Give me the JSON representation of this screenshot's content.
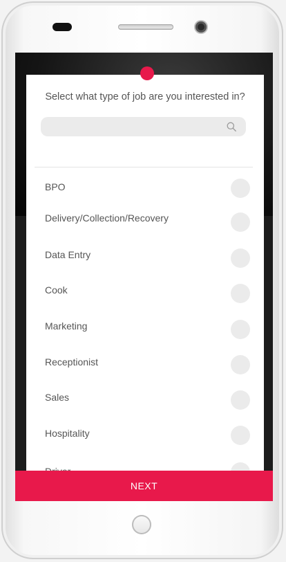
{
  "screen": {
    "prompt": "Select what type of job are you interested in?",
    "search": {
      "placeholder": "",
      "icon": "search-icon"
    },
    "job_types": [
      {
        "label": "BPO",
        "selected": false
      },
      {
        "label": "Delivery/Collection/Recovery",
        "selected": false
      },
      {
        "label": "Data Entry",
        "selected": false
      },
      {
        "label": "Cook",
        "selected": false
      },
      {
        "label": "Marketing",
        "selected": false
      },
      {
        "label": "Receptionist",
        "selected": false
      },
      {
        "label": "Sales",
        "selected": false
      },
      {
        "label": "Hospitality",
        "selected": false
      },
      {
        "label": "Driver",
        "selected": false
      }
    ],
    "next_label": "NEXT"
  },
  "colors": {
    "accent": "#e8194b",
    "text": "#555555",
    "radio_bg": "#ebebeb"
  }
}
